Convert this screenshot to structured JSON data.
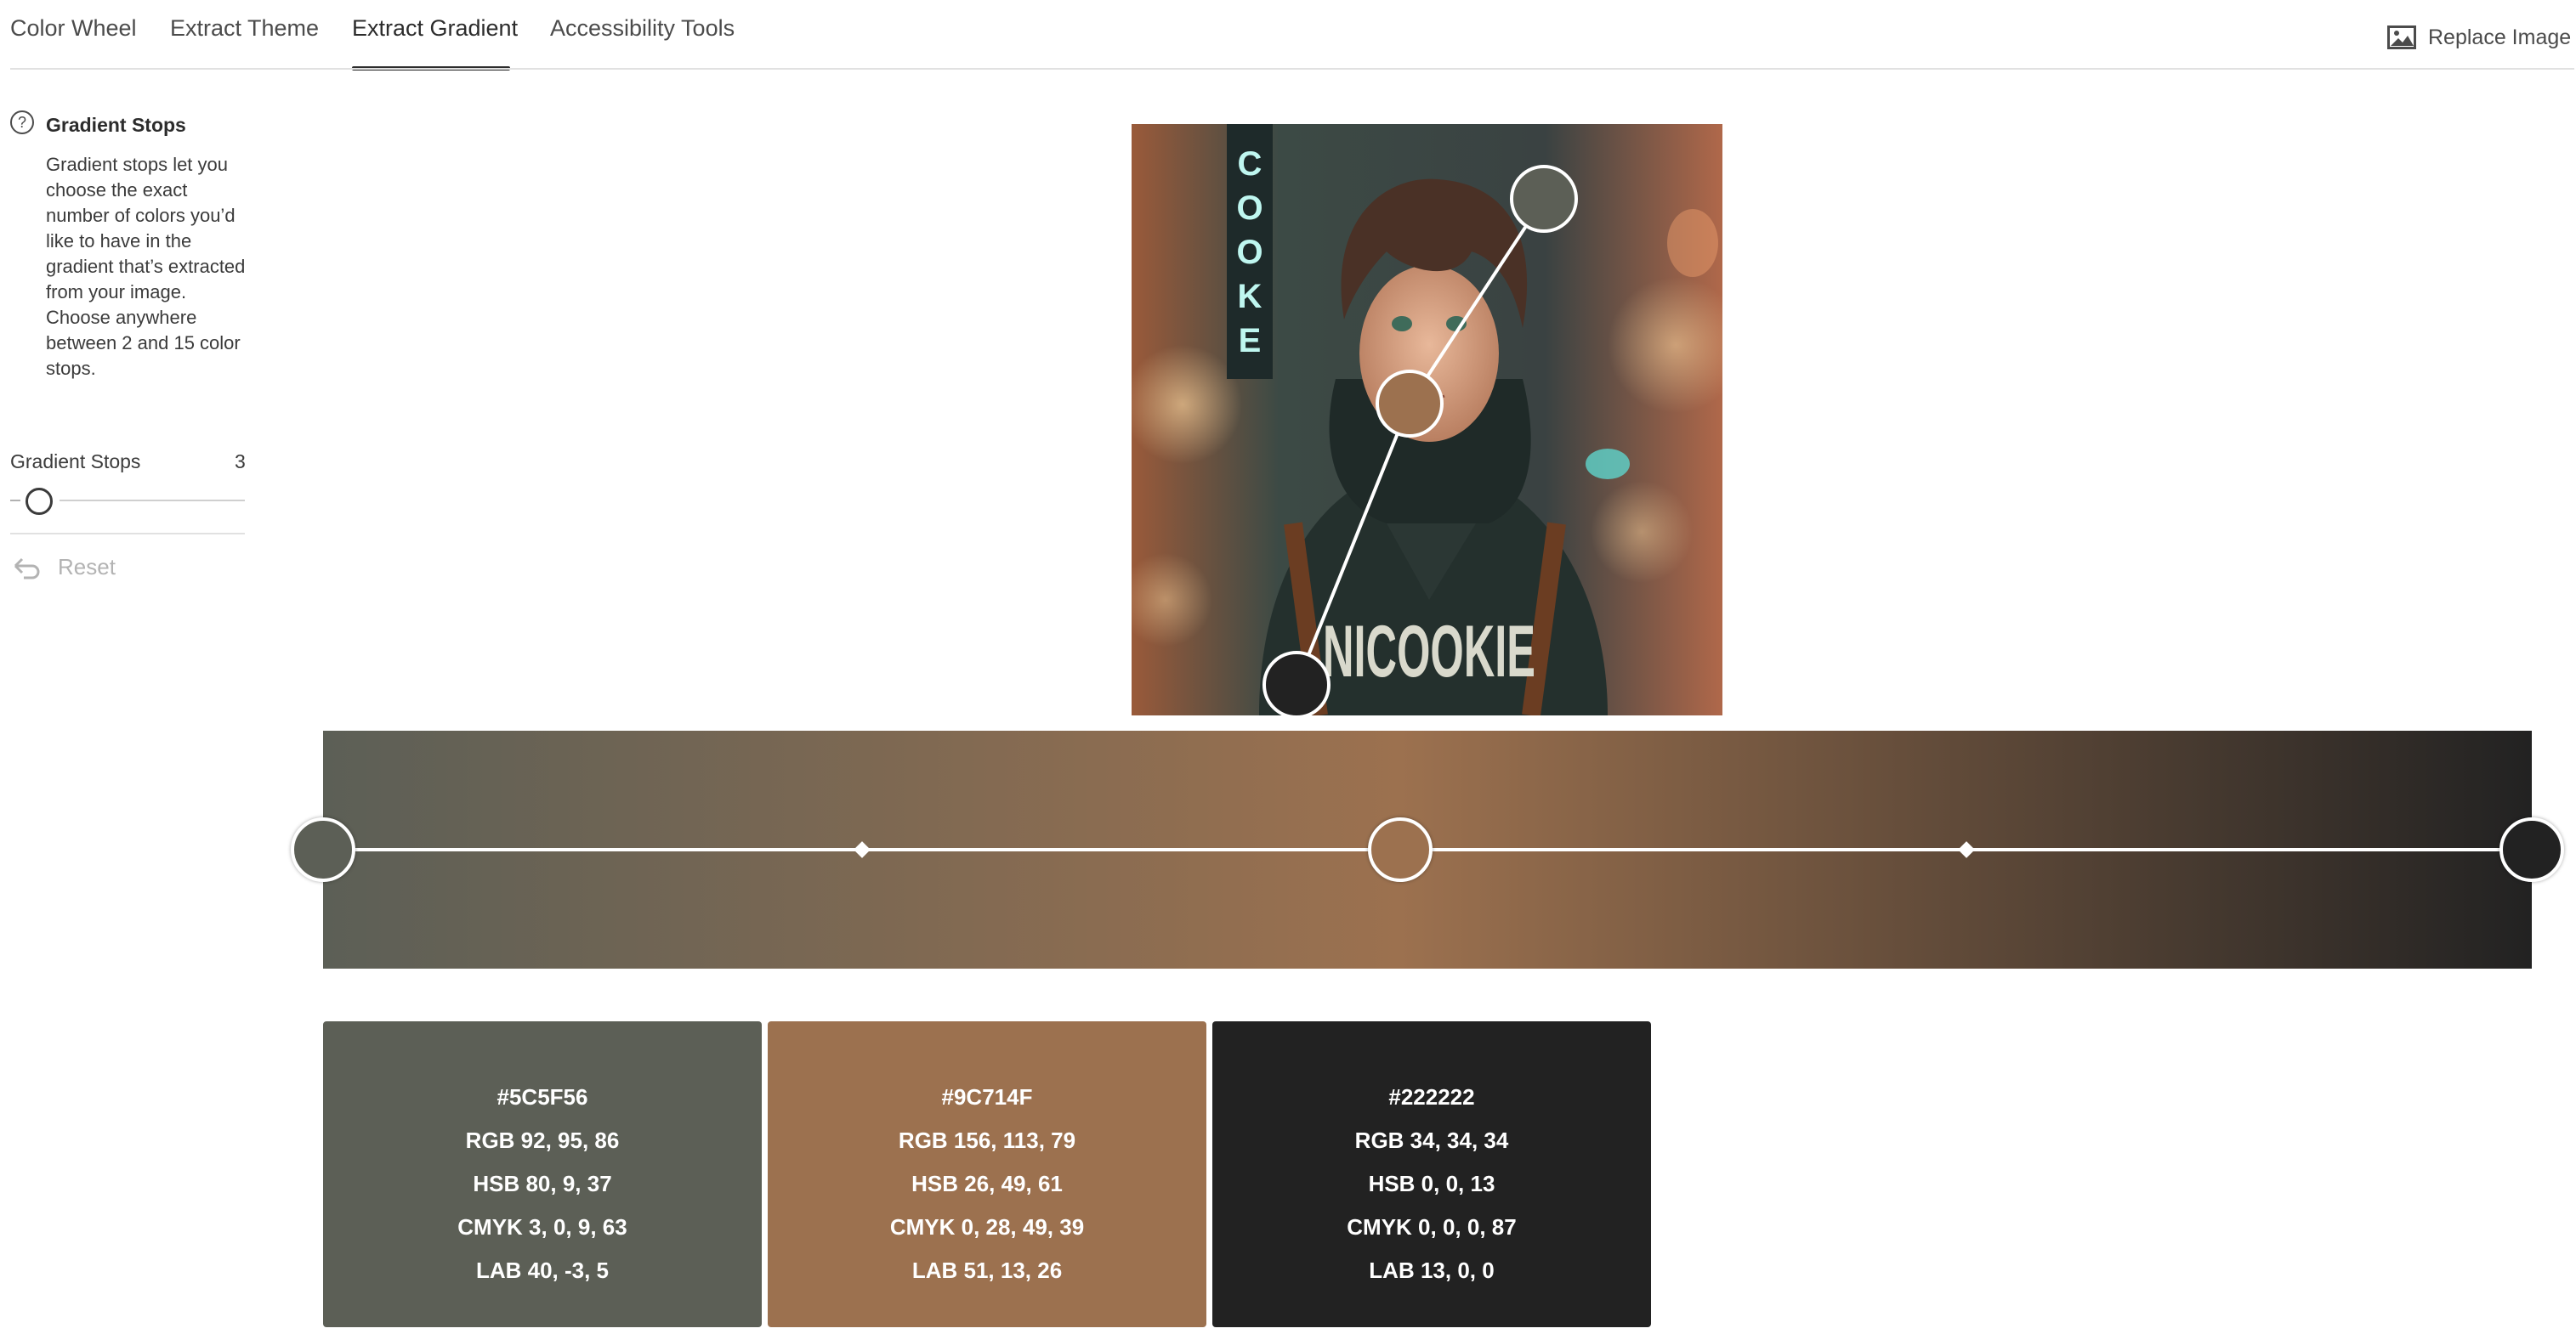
{
  "nav": {
    "tabs": [
      {
        "label": "Color Wheel",
        "active": false
      },
      {
        "label": "Extract Theme",
        "active": false
      },
      {
        "label": "Extract Gradient",
        "active": true
      },
      {
        "label": "Accessibility Tools",
        "active": false
      }
    ],
    "replace_image_label": "Replace Image",
    "replace_image_icon": "image-icon"
  },
  "sidebar": {
    "help_icon": "question-circle-icon",
    "help_title": "Gradient Stops",
    "help_text": "Gradient stops let you choose the exact number of colors you’d like to have in the gradient that’s extracted from your image. Choose anywhere between 2 and 15 color stops.",
    "stops_label": "Gradient Stops",
    "stops_value": "3",
    "stops_min": 2,
    "stops_max": 15,
    "reset_label": "Reset",
    "reset_icon": "undo-icon"
  },
  "gradient": {
    "colors": [
      "#5C5F56",
      "#9C714F",
      "#222222"
    ],
    "stop_positions": [
      0,
      0.4875,
      1
    ],
    "midpoints": [
      0.244,
      0.744
    ]
  },
  "swatches": [
    {
      "hex": "#5C5F56",
      "rgb": "RGB 92, 95, 86",
      "hsb": "HSB 80, 9, 37",
      "cmyk": "CMYK 3, 0, 9, 63",
      "lab": "LAB 40, -3, 5"
    },
    {
      "hex": "#9C714F",
      "rgb": "RGB 156, 113, 79",
      "hsb": "HSB 26, 49, 61",
      "cmyk": "CMYK 0, 28, 49, 39",
      "lab": "LAB 51, 13, 26"
    },
    {
      "hex": "#222222",
      "rgb": "RGB 34, 34, 34",
      "hsb": "HSB 0, 0, 13",
      "cmyk": "CMYK 0, 0, 0, 87",
      "lab": "LAB 13, 0, 0"
    }
  ],
  "image": {
    "shirt_text": "NICOOKIE",
    "sign_text": "COOKE"
  }
}
